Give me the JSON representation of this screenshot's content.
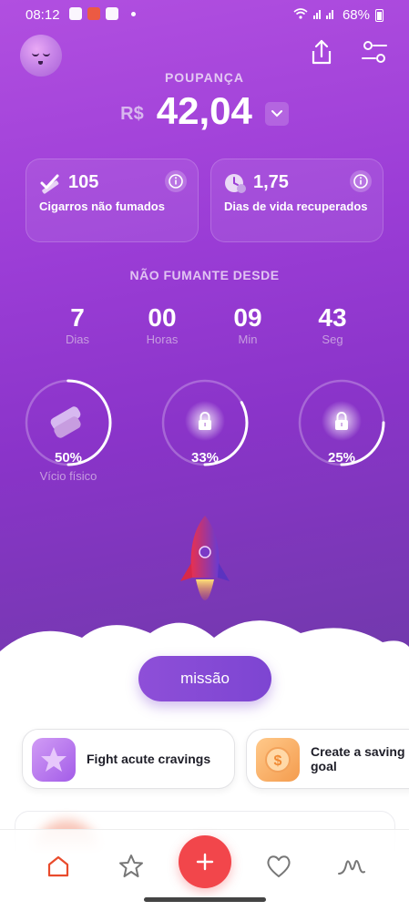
{
  "status_bar": {
    "time": "08:12",
    "battery": "68%"
  },
  "header": {
    "savings_label": "POUPANÇA",
    "currency": "R$",
    "amount": "42,04"
  },
  "stats": [
    {
      "value": "105",
      "label": "Cigarros não fumados",
      "icon": "cigarette-check-icon"
    },
    {
      "value": "1,75",
      "label": "Dias de vida recuperados",
      "icon": "clock-icon"
    }
  ],
  "since": {
    "label": "NÃO FUMANTE DESDE",
    "units": [
      {
        "value": "7",
        "label": "Dias"
      },
      {
        "value": "00",
        "label": "Horas"
      },
      {
        "value": "09",
        "label": "Min"
      },
      {
        "value": "43",
        "label": "Seg"
      }
    ]
  },
  "progress": [
    {
      "percent": "50%",
      "fraction": 0.5,
      "caption": "Vício físico",
      "locked": false
    },
    {
      "percent": "33%",
      "fraction": 0.33,
      "caption": "",
      "locked": true
    },
    {
      "percent": "25%",
      "fraction": 0.25,
      "caption": "",
      "locked": true
    }
  ],
  "mission_button": "missão",
  "tasks": [
    {
      "title": "Fight acute cravings",
      "icon": "star-icon",
      "color": "#b470ea"
    },
    {
      "title": "Create a saving\ngoal",
      "icon": "coin-icon",
      "color": "#f7b26a"
    }
  ],
  "nav": [
    "home-icon",
    "star-icon",
    "add-icon",
    "heart-icon",
    "chart-icon"
  ],
  "colors": {
    "accent_purple": "#8e4fd8",
    "add_red": "#f2464b",
    "home_active": "#e94b2c"
  }
}
